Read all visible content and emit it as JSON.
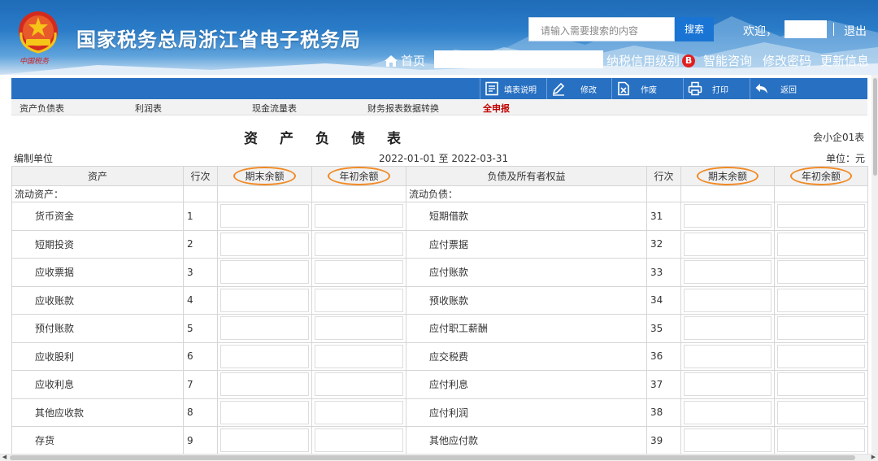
{
  "header": {
    "site_title": "国家税务总局浙江省电子税务局",
    "slogan": "中国税务",
    "search_placeholder": "请输入需要搜索的内容",
    "search_button": "搜索",
    "welcome": "欢迎，",
    "logout": "退出",
    "home": "首页",
    "credit_label": "纳税信用级别",
    "credit_level": "B",
    "links": [
      "智能咨询",
      "修改密码",
      "更新信息"
    ]
  },
  "toolbar": {
    "items": [
      {
        "label": "填表说明",
        "icon": "document-icon"
      },
      {
        "label": "修改",
        "icon": "pencil-icon"
      },
      {
        "label": "作废",
        "icon": "void-icon"
      },
      {
        "label": "打印",
        "icon": "printer-icon"
      },
      {
        "label": "返回",
        "icon": "back-arrow-icon"
      }
    ]
  },
  "tabs": [
    {
      "label": "资产负债表",
      "active": false
    },
    {
      "label": "利润表",
      "active": false
    },
    {
      "label": "现金流量表",
      "active": false
    },
    {
      "label": "财务报表数据转换",
      "active": false
    },
    {
      "label": "全申报",
      "active": true
    }
  ],
  "report": {
    "title": "资产负债表",
    "form_code": "会小企01表",
    "org_label": "编制单位",
    "period": "2022-01-01 至 2022-03-31",
    "unit": "单位：元"
  },
  "table": {
    "headers": [
      "资产",
      "行次",
      "期末余额",
      "年初余额",
      "负债及所有者权益",
      "行次",
      "期末余额",
      "年初余额"
    ],
    "left_section": "流动资产：",
    "right_section": "流动负债：",
    "rows": [
      {
        "left_name": "货币资金",
        "left_line": "1",
        "right_name": "短期借款",
        "right_line": "31"
      },
      {
        "left_name": "短期投资",
        "left_line": "2",
        "right_name": "应付票据",
        "right_line": "32"
      },
      {
        "left_name": "应收票据",
        "left_line": "3",
        "right_name": "应付账款",
        "right_line": "33"
      },
      {
        "left_name": "应收账款",
        "left_line": "4",
        "right_name": "预收账款",
        "right_line": "34"
      },
      {
        "left_name": "预付账款",
        "left_line": "5",
        "right_name": "应付职工薪酬",
        "right_line": "35"
      },
      {
        "left_name": "应收股利",
        "left_line": "6",
        "right_name": "应交税费",
        "right_line": "36"
      },
      {
        "left_name": "应收利息",
        "left_line": "7",
        "right_name": "应付利息",
        "right_line": "37"
      },
      {
        "left_name": "其他应收款",
        "left_line": "8",
        "right_name": "应付利润",
        "right_line": "38"
      },
      {
        "left_name": "存货",
        "left_line": "9",
        "right_name": "其他应付款",
        "right_line": "39"
      }
    ]
  },
  "colors": {
    "header_blue": "#1f6bb8",
    "toolbar_blue": "#2770c2",
    "active_tab": "#c00000",
    "highlight_circle": "#f08a24",
    "credit_badge": "#e02020"
  }
}
